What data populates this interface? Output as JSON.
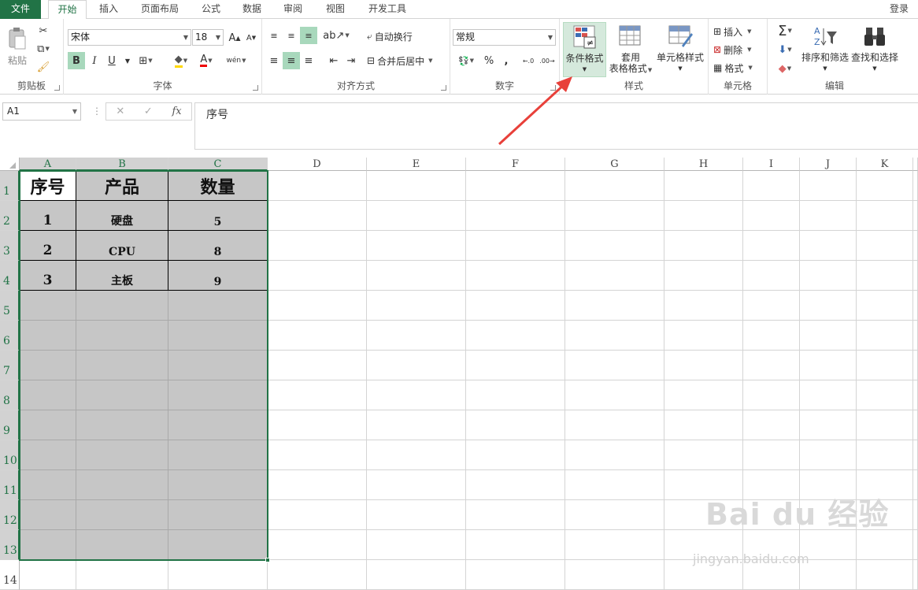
{
  "tabs": {
    "file": "文件",
    "items": [
      "开始",
      "插入",
      "页面布局",
      "公式",
      "数据",
      "审阅",
      "视图",
      "开发工具"
    ],
    "login": "登录"
  },
  "ribbon": {
    "clipboard": {
      "label": "剪贴板",
      "paste": "粘贴"
    },
    "font": {
      "label": "字体",
      "name": "宋体",
      "size": "18",
      "bold": "B",
      "italic": "I",
      "underline": "U",
      "grow": "A",
      "shrink": "A",
      "phonetic": "wén",
      "font_color": "A"
    },
    "alignment": {
      "label": "对齐方式",
      "wrap": "自动换行",
      "merge": "合并后居中"
    },
    "number": {
      "label": "数字",
      "format": "常规",
      "percent": "%",
      "comma": ",",
      "inc": "←.0",
      "dec": ".00→"
    },
    "styles": {
      "label": "样式",
      "conditional": "条件格式",
      "table_line1": "套用",
      "table_line2": "表格格式",
      "cell_styles": "单元格样式"
    },
    "cells": {
      "label": "单元格",
      "insert": "插入",
      "delete": "删除",
      "format": "格式"
    },
    "editing": {
      "label": "编辑",
      "sort": "排序和筛选",
      "find": "查找和选择"
    }
  },
  "formula": {
    "namebox": "A1",
    "content": "序号"
  },
  "grid": {
    "columns": [
      "A",
      "B",
      "C",
      "D",
      "E",
      "F",
      "G",
      "H",
      "I",
      "J",
      "K"
    ],
    "rows": [
      "1",
      "2",
      "3",
      "4",
      "5",
      "6",
      "7",
      "8",
      "9",
      "10",
      "11",
      "12",
      "13",
      "14"
    ],
    "cells": [
      [
        "序号",
        "产品",
        "数量"
      ],
      [
        "1",
        "硬盘",
        "5"
      ],
      [
        "2",
        "CPU",
        "8"
      ],
      [
        "3",
        "主板",
        "9"
      ]
    ]
  },
  "watermark": {
    "brand": "Bai du 经验",
    "url": "jingyan.baidu.com"
  },
  "colors": {
    "accent": "#217346",
    "selection_fill": "#c6c6c6",
    "arrow": "#e8403a"
  }
}
